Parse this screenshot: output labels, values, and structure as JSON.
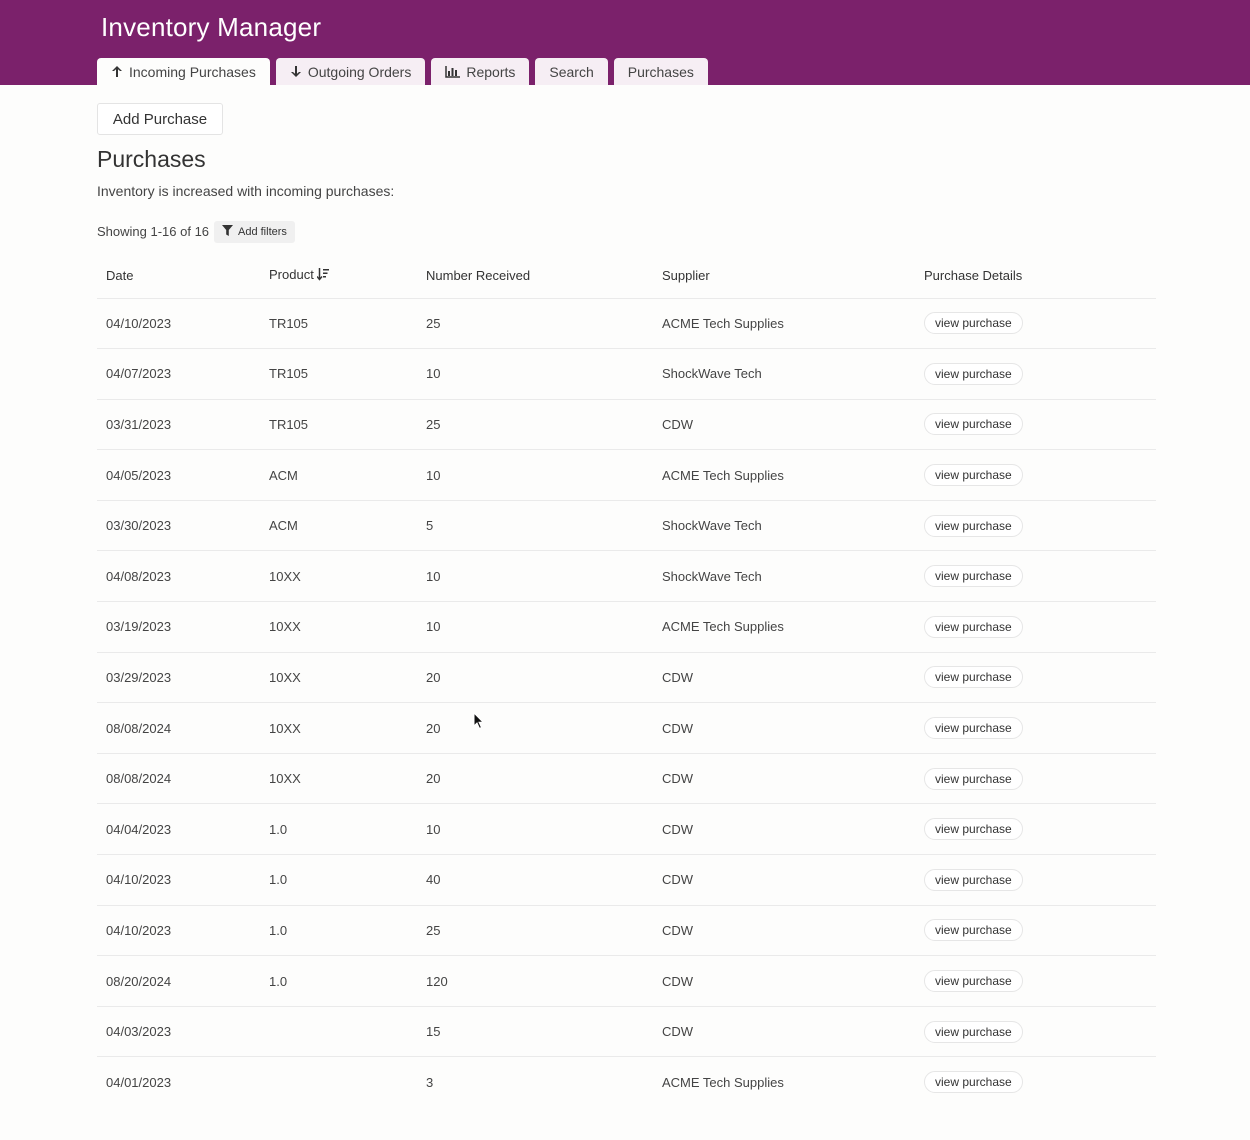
{
  "app": {
    "title": "Inventory Manager"
  },
  "tabs": [
    {
      "label": "Incoming Purchases",
      "icon": "arrow-up-icon",
      "active": true
    },
    {
      "label": "Outgoing Orders",
      "icon": "arrow-down-icon",
      "active": false
    },
    {
      "label": "Reports",
      "icon": "bar-chart-icon",
      "active": false
    },
    {
      "label": "Search",
      "icon": null,
      "active": false
    },
    {
      "label": "Purchases",
      "icon": null,
      "active": false
    }
  ],
  "actions": {
    "add_purchase_label": "Add Purchase"
  },
  "page": {
    "title": "Purchases",
    "subtitle": "Inventory is increased with incoming purchases:"
  },
  "pagination": {
    "showing_text": "Showing 1-16 of 16"
  },
  "filters": {
    "add_label": "Add filters"
  },
  "table": {
    "columns": [
      "Date",
      "Product",
      "Number Received",
      "Supplier",
      "Purchase Details"
    ],
    "sorted_by": "Product",
    "row_action_label": "view purchase",
    "rows": [
      {
        "date": "04/10/2023",
        "product": "TR105",
        "number": "25",
        "supplier": "ACME Tech Supplies"
      },
      {
        "date": "04/07/2023",
        "product": "TR105",
        "number": "10",
        "supplier": "ShockWave Tech"
      },
      {
        "date": "03/31/2023",
        "product": "TR105",
        "number": "25",
        "supplier": "CDW"
      },
      {
        "date": "04/05/2023",
        "product": "ACM",
        "number": "10",
        "supplier": "ACME Tech Supplies"
      },
      {
        "date": "03/30/2023",
        "product": "ACM",
        "number": "5",
        "supplier": "ShockWave Tech"
      },
      {
        "date": "04/08/2023",
        "product": "10XX",
        "number": "10",
        "supplier": "ShockWave Tech"
      },
      {
        "date": "03/19/2023",
        "product": "10XX",
        "number": "10",
        "supplier": "ACME Tech Supplies"
      },
      {
        "date": "03/29/2023",
        "product": "10XX",
        "number": "20",
        "supplier": "CDW"
      },
      {
        "date": "08/08/2024",
        "product": "10XX",
        "number": "20",
        "supplier": "CDW"
      },
      {
        "date": "08/08/2024",
        "product": "10XX",
        "number": "20",
        "supplier": "CDW"
      },
      {
        "date": "04/04/2023",
        "product": "1.0",
        "number": "10",
        "supplier": "CDW"
      },
      {
        "date": "04/10/2023",
        "product": "1.0",
        "number": "40",
        "supplier": "CDW"
      },
      {
        "date": "04/10/2023",
        "product": "1.0",
        "number": "25",
        "supplier": "CDW"
      },
      {
        "date": "08/20/2024",
        "product": "1.0",
        "number": "120",
        "supplier": "CDW"
      },
      {
        "date": "04/03/2023",
        "product": "",
        "number": "15",
        "supplier": "CDW"
      },
      {
        "date": "04/01/2023",
        "product": "",
        "number": "3",
        "supplier": "ACME Tech Supplies"
      }
    ]
  },
  "colors": {
    "header_bg": "#7b216b",
    "tab_bg": "#f6eef4",
    "page_bg": "#fdfdfc"
  }
}
